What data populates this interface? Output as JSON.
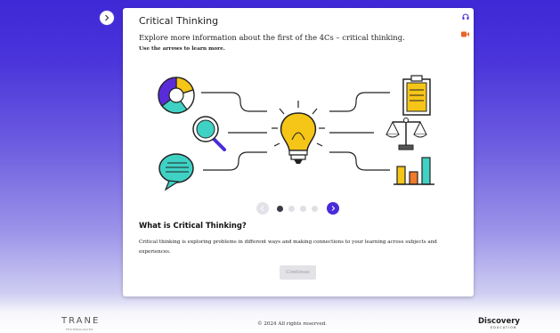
{
  "lesson": {
    "title": "Critical Thinking",
    "subtitle": "Explore more information about the first of the 4Cs – critical thinking.",
    "instruction": "Use the arrows to learn more."
  },
  "carousel": {
    "total_slides": 4,
    "current_slide": 1
  },
  "content": {
    "heading": "What is Critical Thinking?",
    "body": "Critical thinking is exploring problems in different ways and making connections to your learning across subjects and experiences."
  },
  "continue_label": "Continue",
  "footer": {
    "trane_logo_text": "TRANE",
    "trane_logo_subtext": "TECHNOLOGIES",
    "copyright": "© 2024 All rights reserved.",
    "discovery_logo_text": "Discovery",
    "discovery_logo_subtext": "EDUCATION"
  },
  "colors": {
    "brand_purple": "#4a2bd9",
    "bulb_yellow": "#f5c518",
    "teal": "#3fd1c4",
    "orange": "#f07b2a",
    "video_icon_orange": "#e8642a"
  },
  "icons": {
    "sidebar_toggle": "chevron-right-icon",
    "audio": "headphones-icon",
    "video": "video-icon",
    "prev": "chevron-left-icon",
    "next": "chevron-right-icon"
  }
}
